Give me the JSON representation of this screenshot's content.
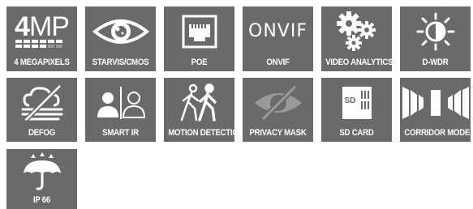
{
  "colors": {
    "tile_bg": "#6a6a6a",
    "icon_fg": "#ffffff",
    "page_bg": "#ffffff"
  },
  "features": [
    {
      "label": "4 MEGAPIXELS",
      "icon": "4mp-icon",
      "icon_text_big": "4",
      "icon_text_thin": "MP"
    },
    {
      "label": "STARVIS/CMOS",
      "icon": "eye-icon"
    },
    {
      "label": "POE",
      "icon": "ethernet-port-icon"
    },
    {
      "label": "ONVIF",
      "icon": "onvif-logo-icon",
      "icon_text": "ONVIF"
    },
    {
      "label": "VIDEO ANALYTICS",
      "icon": "gears-icon"
    },
    {
      "label": "D-WDR",
      "icon": "sun-half-icon"
    },
    {
      "label": "DEFOG",
      "icon": "fog-cloud-slash-icon"
    },
    {
      "label": "SMART IR",
      "icon": "person-compare-icon"
    },
    {
      "label": "MOTION DETECTION",
      "icon": "walking-people-icon"
    },
    {
      "label": "PRIVACY MASK",
      "icon": "eye-slash-icon"
    },
    {
      "label": "SD CARD",
      "icon": "sd-card-icon",
      "icon_text": "SD"
    },
    {
      "label": "CORRIDOR MODE",
      "icon": "corridor-icon"
    },
    {
      "label": "IP 66",
      "icon": "umbrella-rain-icon"
    }
  ]
}
